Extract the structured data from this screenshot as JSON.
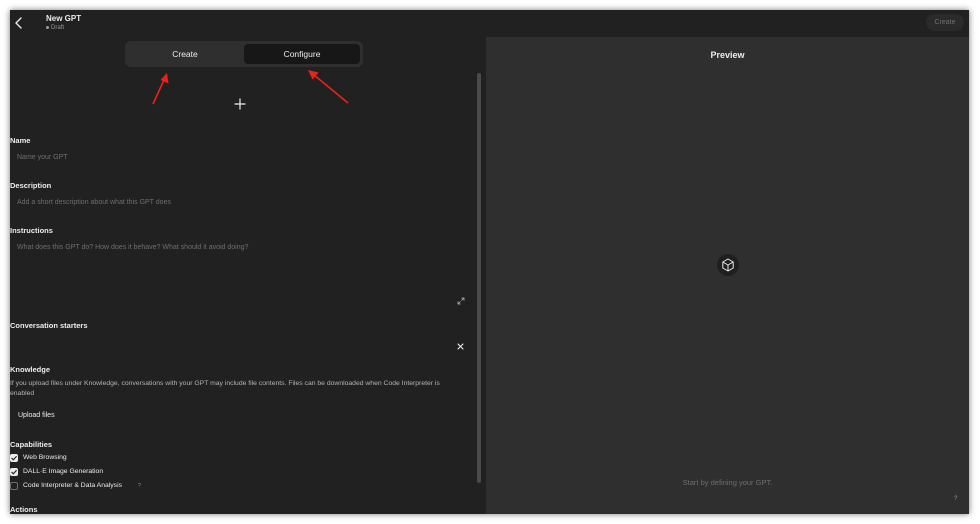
{
  "header": {
    "title": "New GPT",
    "status": "Draft",
    "create_button": "Create"
  },
  "tabs": [
    {
      "label": "Create",
      "active": false
    },
    {
      "label": "Configure",
      "active": true
    }
  ],
  "form": {
    "name": {
      "label": "Name",
      "placeholder": "Name your GPT"
    },
    "description": {
      "label": "Description",
      "placeholder": "Add a short description about what this GPT does"
    },
    "instructions": {
      "label": "Instructions",
      "placeholder": "What does this GPT do? How does it behave? What should it avoid doing?"
    },
    "conversation_starters": {
      "label": "Conversation starters"
    },
    "knowledge": {
      "label": "Knowledge",
      "help": "If you upload files under Knowledge, conversations with your GPT may include file contents. Files can be downloaded when Code Interpreter is enabled",
      "upload_button": "Upload files"
    },
    "capabilities": {
      "label": "Capabilities",
      "items": [
        {
          "label": "Web Browsing",
          "checked": true
        },
        {
          "label": "DALL·E Image Generation",
          "checked": true
        },
        {
          "label": "Code Interpreter & Data Analysis",
          "checked": false
        }
      ],
      "info_mark": "?"
    },
    "actions": {
      "label": "Actions"
    }
  },
  "preview": {
    "title": "Preview",
    "hint": "Start by defining your GPT.",
    "help": "?"
  },
  "colors": {
    "background": "#212121",
    "preview_background": "#2f2f2f",
    "annotation_arrow": "#e8231a"
  },
  "icons": {
    "back": "chevron-left-icon",
    "add_image": "plus-icon",
    "expand": "expand-icon",
    "clear": "close-icon",
    "preview": "cube-icon"
  }
}
